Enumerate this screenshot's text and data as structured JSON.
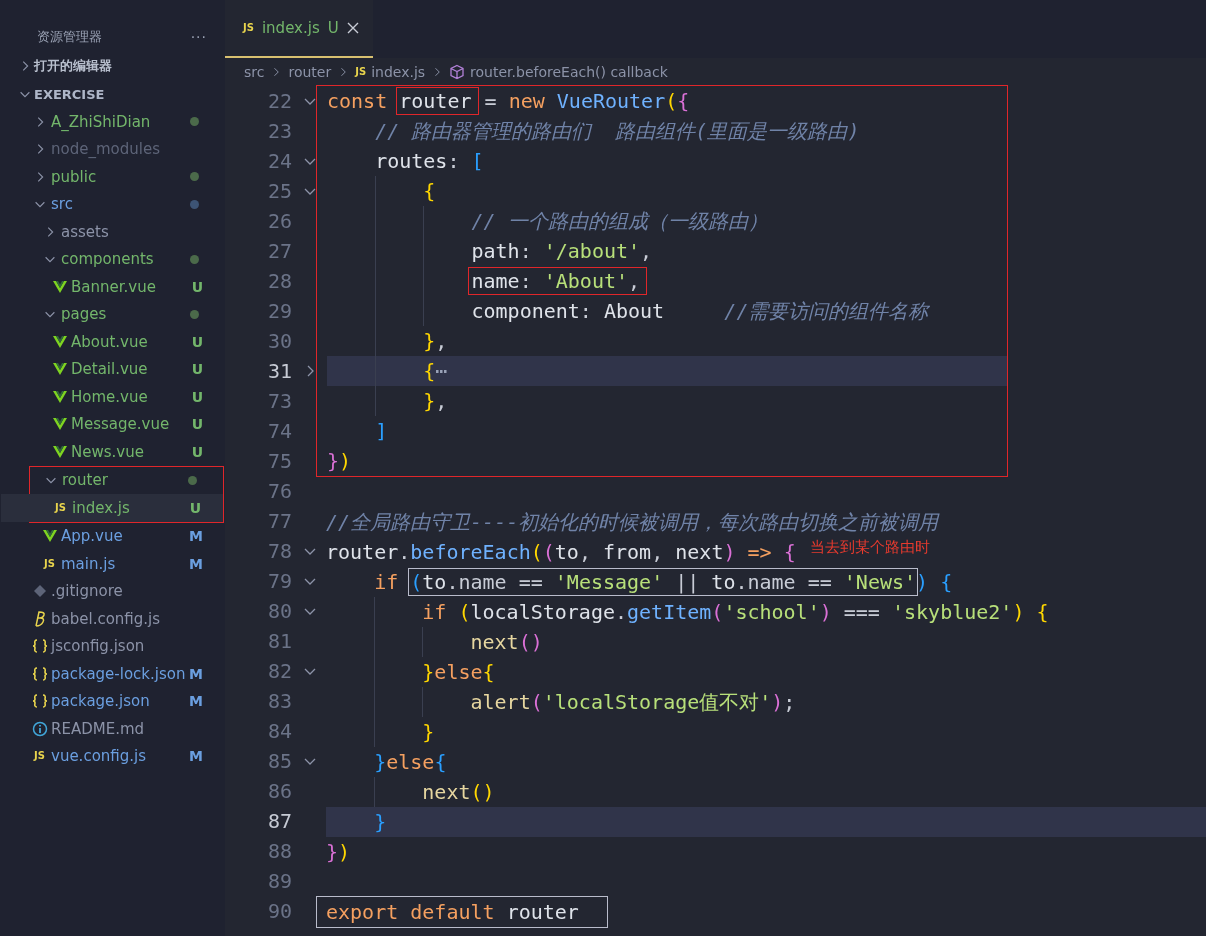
{
  "explorer": {
    "title": "资源管理器",
    "more": "···",
    "sections": [
      {
        "label": "打开的编辑器",
        "expanded": false
      },
      {
        "label": "EXERCISE",
        "expanded": true,
        "children": [
          {
            "label": "A_ZhiShiDian",
            "kind": "folder",
            "untracked": true,
            "color": "#4b6a4a",
            "expanded": false,
            "selected": false,
            "outlined": false
          },
          {
            "label": "node_modules",
            "kind": "folder",
            "ignored": true,
            "expanded": false,
            "selected": false,
            "outlined": false
          },
          {
            "label": "public",
            "kind": "folder",
            "untracked": true,
            "color": "#4b6a4a",
            "expanded": false,
            "selected": false,
            "outlined": false
          },
          {
            "label": "src",
            "kind": "folder",
            "modified": true,
            "color": "#3d5475",
            "expanded": true,
            "selected": false,
            "outlined": false,
            "children": [
              {
                "label": "assets",
                "kind": "folder",
                "expanded": false,
                "selected": false,
                "outlined": false
              },
              {
                "label": "components",
                "kind": "folder",
                "untracked": true,
                "color": "#4b6a4a",
                "expanded": true,
                "selected": false,
                "outlined": false,
                "children": [
                  {
                    "label": "Banner.vue",
                    "kind": "vue",
                    "untracked": true,
                    "badge": "U",
                    "selected": false,
                    "outlined": false
                  }
                ]
              },
              {
                "label": "pages",
                "kind": "folder",
                "untracked": true,
                "color": "#4b6a4a",
                "expanded": true,
                "selected": false,
                "outlined": false,
                "children": [
                  {
                    "label": "About.vue",
                    "kind": "vue",
                    "untracked": true,
                    "badge": "U",
                    "selected": false,
                    "outlined": false
                  },
                  {
                    "label": "Detail.vue",
                    "kind": "vue",
                    "untracked": true,
                    "badge": "U",
                    "selected": false,
                    "outlined": false
                  },
                  {
                    "label": "Home.vue",
                    "kind": "vue",
                    "untracked": true,
                    "badge": "U",
                    "selected": false,
                    "outlined": false
                  },
                  {
                    "label": "Message.vue",
                    "kind": "vue",
                    "untracked": true,
                    "badge": "U",
                    "selected": false,
                    "outlined": false
                  },
                  {
                    "label": "News.vue",
                    "kind": "vue",
                    "untracked": true,
                    "badge": "U",
                    "selected": false,
                    "outlined": false
                  }
                ]
              },
              {
                "label": "router",
                "kind": "folder",
                "untracked": true,
                "color": "#4b6a4a",
                "expanded": true,
                "selected": false,
                "outlined": true,
                "children": [
                  {
                    "label": "index.js",
                    "kind": "js",
                    "icon_label": "JS",
                    "untracked": true,
                    "badge": "U",
                    "selected": true,
                    "outlined": false
                  }
                ]
              },
              {
                "label": "App.vue",
                "kind": "vue",
                "modified": true,
                "badge": "M",
                "selected": false,
                "outlined": false
              },
              {
                "label": "main.js",
                "kind": "js",
                "icon_label": "JS",
                "modified": true,
                "badge": "M",
                "selected": false,
                "outlined": false
              }
            ]
          },
          {
            "label": ".gitignore",
            "kind": "git",
            "selected": false,
            "outlined": false
          },
          {
            "label": "babel.config.js",
            "kind": "babel",
            "selected": false,
            "outlined": false
          },
          {
            "label": "jsconfig.json",
            "kind": "json",
            "selected": false,
            "outlined": false
          },
          {
            "label": "package-lock.json",
            "kind": "json",
            "modified": true,
            "badge": "M",
            "selected": false,
            "outlined": false
          },
          {
            "label": "package.json",
            "kind": "json",
            "modified": true,
            "badge": "M",
            "selected": false,
            "outlined": false
          },
          {
            "label": "README.md",
            "kind": "info",
            "selected": false,
            "outlined": false
          },
          {
            "label": "vue.config.js",
            "kind": "js",
            "icon_label": "JS",
            "modified": true,
            "badge": "M",
            "selected": false,
            "outlined": false
          }
        ]
      }
    ]
  },
  "tabs": [
    {
      "label": "index.js",
      "icon_label": "JS",
      "badge": "U",
      "selected": true
    }
  ],
  "breadcrumb": [
    {
      "label": "src",
      "kind": "plain"
    },
    {
      "label": "router",
      "kind": "plain"
    },
    {
      "label": "index.js",
      "kind": "js",
      "icon_label": "JS"
    },
    {
      "label": "router.beforeEach() callback",
      "kind": "symbol"
    }
  ],
  "editor": {
    "blocks": [
      {
        "outlined": true,
        "lines": [
          {
            "number": "22",
            "folded": false,
            "highlighted": false,
            "segments": [
              {
                "kind": "plain",
                "tokens": [
                  {
                    "text": "const ",
                    "kind": "kw"
                  }
                ]
              },
              {
                "kind": "boxed",
                "tokens": [
                  {
                    "text": "router",
                    "kind": "var"
                  }
                ]
              },
              {
                "kind": "plain",
                "tokens": [
                  {
                    "text": " = ",
                    "kind": "op"
                  },
                  {
                    "text": "new ",
                    "kind": "kw"
                  },
                  {
                    "text": "VueRouter",
                    "kind": "fn"
                  },
                  {
                    "text": "(",
                    "kind": "b1"
                  },
                  {
                    "text": "{",
                    "kind": "b2"
                  }
                ]
              }
            ]
          },
          {
            "number": "23",
            "highlighted": false,
            "segments": [
              {
                "kind": "plain",
                "tokens": [
                  {
                    "text": "    // 路由器管理的路由们  路由组件(里面是一级路由)",
                    "kind": "comment"
                  }
                ]
              }
            ]
          },
          {
            "number": "24",
            "folded": false,
            "highlighted": false,
            "segments": [
              {
                "kind": "plain",
                "tokens": [
                  {
                    "text": "    routes",
                    "kind": "var"
                  },
                  {
                    "text": ": ",
                    "kind": "op"
                  },
                  {
                    "text": "[",
                    "kind": "b3"
                  }
                ]
              }
            ]
          },
          {
            "number": "25",
            "folded": false,
            "highlighted": false,
            "segments": [
              {
                "kind": "plain",
                "tokens": [
                  {
                    "text": "        {",
                    "kind": "b1"
                  }
                ]
              }
            ]
          },
          {
            "number": "26",
            "highlighted": false,
            "segments": [
              {
                "kind": "plain",
                "tokens": [
                  {
                    "text": "            // 一个路由的组成（一级路由）",
                    "kind": "comment"
                  }
                ]
              }
            ]
          },
          {
            "number": "27",
            "highlighted": false,
            "segments": [
              {
                "kind": "plain",
                "tokens": [
                  {
                    "text": "            path",
                    "kind": "var"
                  },
                  {
                    "text": ": ",
                    "kind": "op"
                  },
                  {
                    "text": "'/about'",
                    "kind": "str"
                  },
                  {
                    "text": ",",
                    "kind": "op"
                  }
                ]
              }
            ]
          },
          {
            "number": "28",
            "highlighted": false,
            "segments": [
              {
                "kind": "boxed",
                "tokens": [
                  {
                    "text": "            name",
                    "kind": "var"
                  },
                  {
                    "text": ": ",
                    "kind": "op"
                  },
                  {
                    "text": "'About'",
                    "kind": "str"
                  },
                  {
                    "text": ",",
                    "kind": "op"
                  }
                ]
              }
            ]
          },
          {
            "number": "29",
            "highlighted": false,
            "segments": [
              {
                "kind": "plain",
                "tokens": [
                  {
                    "text": "            component",
                    "kind": "var"
                  },
                  {
                    "text": ": ",
                    "kind": "op"
                  },
                  {
                    "text": "About",
                    "kind": "var"
                  },
                  {
                    "text": "     //需要访问的组件名称",
                    "kind": "comment"
                  }
                ]
              }
            ]
          },
          {
            "number": "30",
            "highlighted": false,
            "segments": [
              {
                "kind": "plain",
                "tokens": [
                  {
                    "text": "        }",
                    "kind": "b1"
                  },
                  {
                    "text": ",",
                    "kind": "op"
                  }
                ]
              }
            ]
          },
          {
            "number": "31",
            "folded": true,
            "highlighted": true,
            "segments": [
              {
                "kind": "plain",
                "tokens": [
                  {
                    "text": "        {",
                    "kind": "b1"
                  },
                  {
                    "text": "⋯",
                    "kind": "dim"
                  }
                ]
              }
            ]
          },
          {
            "number": "73",
            "highlighted": false,
            "segments": [
              {
                "kind": "plain",
                "tokens": [
                  {
                    "text": "        }",
                    "kind": "b1"
                  },
                  {
                    "text": ",",
                    "kind": "op"
                  }
                ]
              }
            ]
          },
          {
            "number": "74",
            "highlighted": false,
            "segments": [
              {
                "kind": "plain",
                "tokens": [
                  {
                    "text": "    ]",
                    "kind": "b3"
                  }
                ]
              }
            ]
          },
          {
            "number": "75",
            "highlighted": false,
            "segments": [
              {
                "kind": "plain",
                "tokens": [
                  {
                    "text": "}",
                    "kind": "b2"
                  },
                  {
                    "text": ")",
                    "kind": "b1"
                  }
                ]
              }
            ]
          }
        ]
      },
      {
        "outlined": false,
        "lines": [
          {
            "number": "76",
            "highlighted": false
          },
          {
            "number": "77",
            "highlighted": false,
            "segments": [
              {
                "kind": "plain",
                "tokens": [
                  {
                    "text": "//全局路由守卫----初始化的时候被调用，每次路由切换之前被调用",
                    "kind": "comment"
                  }
                ]
              }
            ]
          },
          {
            "number": "78",
            "folded": false,
            "highlighted": false,
            "annotation": "当去到某个路由时",
            "segments": [
              {
                "kind": "plain",
                "tokens": [
                  {
                    "text": "router",
                    "kind": "var"
                  },
                  {
                    "text": ".",
                    "kind": "op"
                  },
                  {
                    "text": "beforeEach",
                    "kind": "fn"
                  },
                  {
                    "text": "(",
                    "kind": "b1"
                  },
                  {
                    "text": "(",
                    "kind": "b2"
                  },
                  {
                    "text": "to",
                    "kind": "var"
                  },
                  {
                    "text": ", ",
                    "kind": "op"
                  },
                  {
                    "text": "from",
                    "kind": "var"
                  },
                  {
                    "text": ", ",
                    "kind": "op"
                  },
                  {
                    "text": "next",
                    "kind": "var"
                  },
                  {
                    "text": ")",
                    "kind": "b2"
                  },
                  {
                    "text": " => ",
                    "kind": "kw"
                  },
                  {
                    "text": "{",
                    "kind": "b2"
                  }
                ]
              }
            ]
          },
          {
            "number": "79",
            "folded": false,
            "highlighted": false,
            "segments": [
              {
                "kind": "plain",
                "tokens": [
                  {
                    "text": "    if ",
                    "kind": "kw"
                  }
                ]
              },
              {
                "kind": "framed",
                "tokens": [
                  {
                    "text": "(",
                    "kind": "b3"
                  },
                  {
                    "text": "to",
                    "kind": "var"
                  },
                  {
                    "text": ".name == ",
                    "kind": "op"
                  },
                  {
                    "text": "'Message'",
                    "kind": "str"
                  },
                  {
                    "text": " || ",
                    "kind": "op"
                  },
                  {
                    "text": "to",
                    "kind": "var"
                  },
                  {
                    "text": ".name == ",
                    "kind": "op"
                  },
                  {
                    "text": "'News'",
                    "kind": "str"
                  }
                ]
              },
              {
                "kind": "plain",
                "tokens": [
                  {
                    "text": ")",
                    "kind": "b3"
                  },
                  {
                    "text": " {",
                    "kind": "b3"
                  }
                ]
              }
            ]
          },
          {
            "number": "80",
            "folded": false,
            "highlighted": false,
            "segments": [
              {
                "kind": "plain",
                "tokens": [
                  {
                    "text": "        if ",
                    "kind": "kw"
                  },
                  {
                    "text": "(",
                    "kind": "b1"
                  },
                  {
                    "text": "localStorage",
                    "kind": "var"
                  },
                  {
                    "text": ".",
                    "kind": "op"
                  },
                  {
                    "text": "getItem",
                    "kind": "fn"
                  },
                  {
                    "text": "(",
                    "kind": "b2"
                  },
                  {
                    "text": "'school'",
                    "kind": "str"
                  },
                  {
                    "text": ")",
                    "kind": "b2"
                  },
                  {
                    "text": " === ",
                    "kind": "op"
                  },
                  {
                    "text": "'skyblue2'",
                    "kind": "str"
                  },
                  {
                    "text": ")",
                    "kind": "b1"
                  },
                  {
                    "text": " {",
                    "kind": "b1"
                  }
                ]
              }
            ]
          },
          {
            "number": "81",
            "highlighted": false,
            "segments": [
              {
                "kind": "plain",
                "tokens": [
                  {
                    "text": "            next",
                    "kind": "call"
                  },
                  {
                    "text": "()",
                    "kind": "b2"
                  }
                ]
              }
            ]
          },
          {
            "number": "82",
            "folded": false,
            "highlighted": false,
            "segments": [
              {
                "kind": "plain",
                "tokens": [
                  {
                    "text": "        }",
                    "kind": "b1"
                  },
                  {
                    "text": "else",
                    "kind": "kw"
                  },
                  {
                    "text": "{",
                    "kind": "b1"
                  }
                ]
              }
            ]
          },
          {
            "number": "83",
            "highlighted": false,
            "segments": [
              {
                "kind": "plain",
                "tokens": [
                  {
                    "text": "            alert",
                    "kind": "call"
                  },
                  {
                    "text": "(",
                    "kind": "b2"
                  },
                  {
                    "text": "'localStorage值不对'",
                    "kind": "str"
                  },
                  {
                    "text": ")",
                    "kind": "b2"
                  },
                  {
                    "text": ";",
                    "kind": "op"
                  }
                ]
              }
            ]
          },
          {
            "number": "84",
            "highlighted": false,
            "segments": [
              {
                "kind": "plain",
                "tokens": [
                  {
                    "text": "        }",
                    "kind": "b1"
                  }
                ]
              }
            ]
          },
          {
            "number": "85",
            "folded": false,
            "highlighted": false,
            "segments": [
              {
                "kind": "plain",
                "tokens": [
                  {
                    "text": "    }",
                    "kind": "b3"
                  },
                  {
                    "text": "else",
                    "kind": "kw"
                  },
                  {
                    "text": "{",
                    "kind": "b3"
                  }
                ]
              }
            ]
          },
          {
            "number": "86",
            "highlighted": false,
            "segments": [
              {
                "kind": "plain",
                "tokens": [
                  {
                    "text": "        next",
                    "kind": "call"
                  },
                  {
                    "text": "()",
                    "kind": "b1"
                  }
                ]
              }
            ]
          },
          {
            "number": "87",
            "highlighted": true,
            "segments": [
              {
                "kind": "plain",
                "tokens": [
                  {
                    "text": "    }",
                    "kind": "b3"
                  }
                ]
              }
            ]
          },
          {
            "number": "88",
            "highlighted": false,
            "segments": [
              {
                "kind": "plain",
                "tokens": [
                  {
                    "text": "}",
                    "kind": "b2"
                  },
                  {
                    "text": ")",
                    "kind": "b1"
                  }
                ]
              }
            ]
          },
          {
            "number": "89",
            "highlighted": false
          },
          {
            "number": "90",
            "highlighted": false,
            "segments": [
              {
                "kind": "banner",
                "tokens": [
                  {
                    "text": "export default ",
                    "kind": "kw"
                  },
                  {
                    "text": "router",
                    "kind": "var"
                  }
                ]
              }
            ]
          }
        ]
      }
    ]
  }
}
